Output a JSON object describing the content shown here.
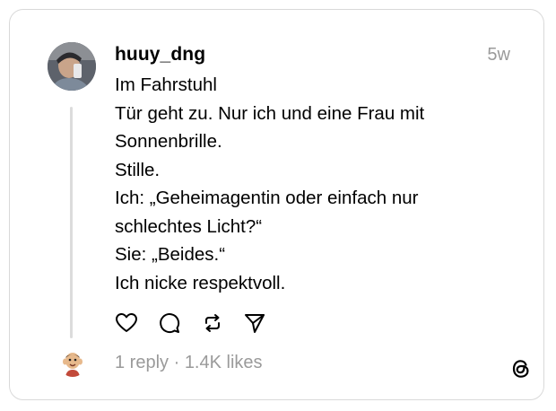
{
  "post": {
    "username": "huuy_dng",
    "time": "5w",
    "lines": [
      "Im Fahrstuhl",
      "Tür geht zu. Nur ich und eine Frau mit",
      "Sonnenbrille.",
      "Stille.",
      "Ich: „Geheimagentin oder einfach nur",
      "schlechtes Licht?“",
      "Sie: „Beides.“",
      "Ich nicke respektvoll."
    ]
  },
  "actions": [
    "heart-icon",
    "comment-icon",
    "repost-icon",
    "share-icon"
  ],
  "footer": {
    "replies": "1 reply",
    "separator": " · ",
    "likes": "1.4K likes"
  },
  "colors": {
    "text": "#000000",
    "muted": "#9a9a9a",
    "border": "#d9d9d9",
    "thread_line": "#dcdcdc"
  }
}
